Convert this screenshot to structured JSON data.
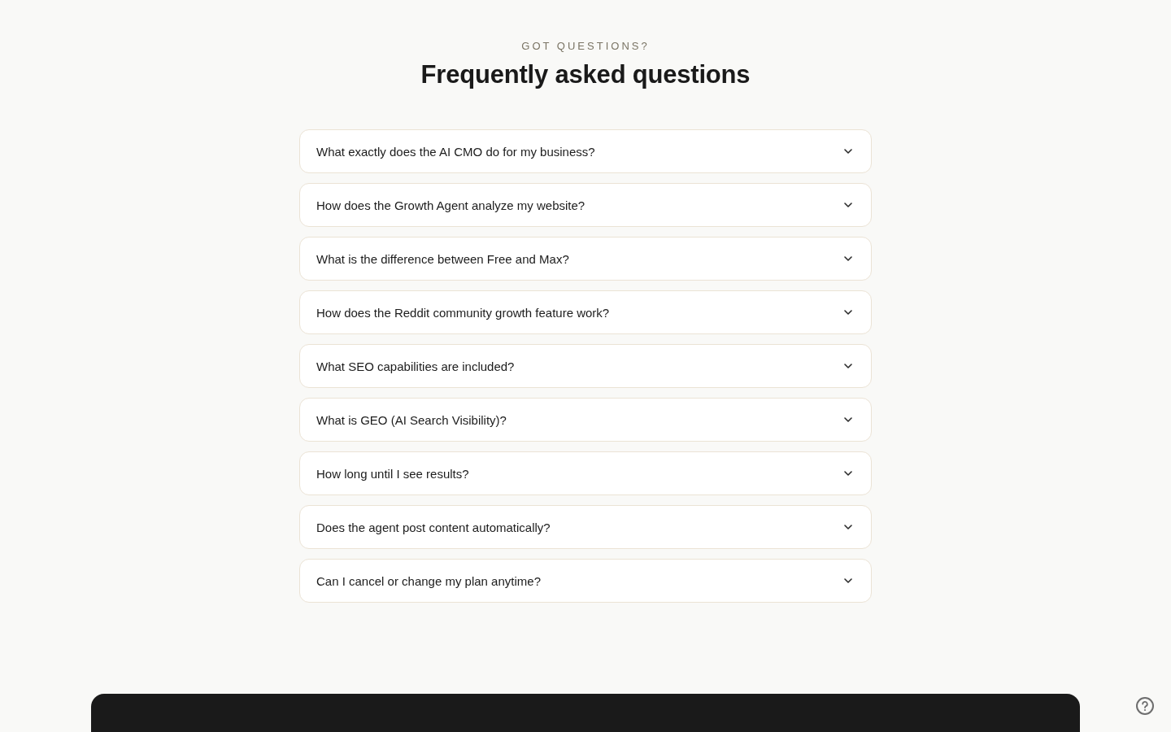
{
  "header": {
    "eyebrow": "GOT QUESTIONS?",
    "title": "Frequently asked questions"
  },
  "faq": [
    {
      "question": "What exactly does the AI CMO do for my business?",
      "expanded": false
    },
    {
      "question": "How does the Growth Agent analyze my website?",
      "expanded": false
    },
    {
      "question": "What is the difference between Free and Max?",
      "expanded": false
    },
    {
      "question": "How does the Reddit community growth feature work?",
      "expanded": false
    },
    {
      "question": "What SEO capabilities are included?",
      "expanded": false
    },
    {
      "question": "What is GEO (AI Search Visibility)?",
      "expanded": false
    },
    {
      "question": "How long until I see results?",
      "expanded": false
    },
    {
      "question": "Does the agent post content automatically?",
      "expanded": false
    },
    {
      "question": "Can I cancel or change my plan anytime?",
      "expanded": false
    }
  ]
}
